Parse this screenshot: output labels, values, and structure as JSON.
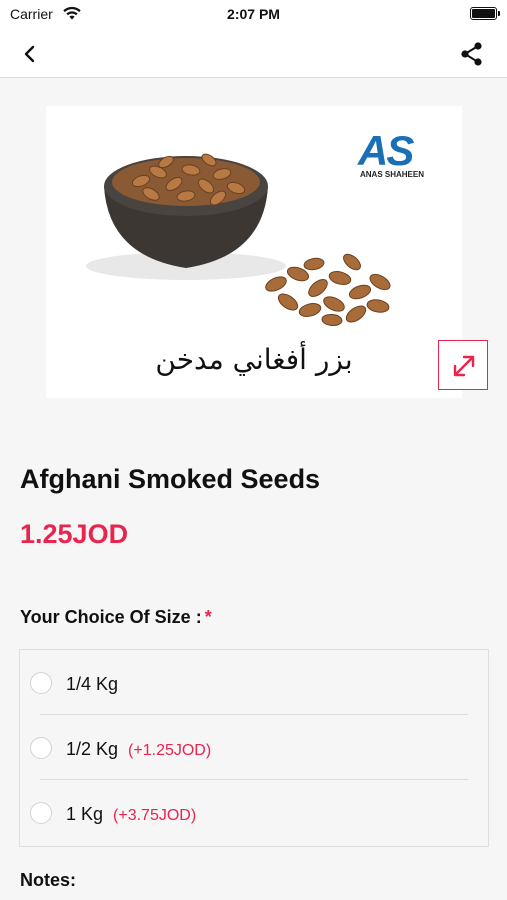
{
  "status_bar": {
    "carrier": "Carrier",
    "time": "2:07 PM"
  },
  "nav": {
    "back_icon": "chevron-left",
    "share_icon": "share"
  },
  "product_image": {
    "logo_letters": "AS",
    "logo_subtext": "ANAS SHAHEEN",
    "caption": "بزر أفغاني مدخن"
  },
  "product": {
    "title": "Afghani Smoked Seeds",
    "price": "1.25JOD"
  },
  "size_section": {
    "label": "Your Choice Of Size :",
    "required_marker": "*",
    "options": [
      {
        "label": "1/4 Kg",
        "extra": ""
      },
      {
        "label": "1/2 Kg",
        "extra": "(+1.25JOD)"
      },
      {
        "label": "1 Kg",
        "extra": "(+3.75JOD)"
      }
    ]
  },
  "notes": {
    "label": "Notes:"
  },
  "colors": {
    "accent": "#e8254e",
    "background": "#f6f6f6",
    "logo_blue": "#1b6fb5"
  }
}
